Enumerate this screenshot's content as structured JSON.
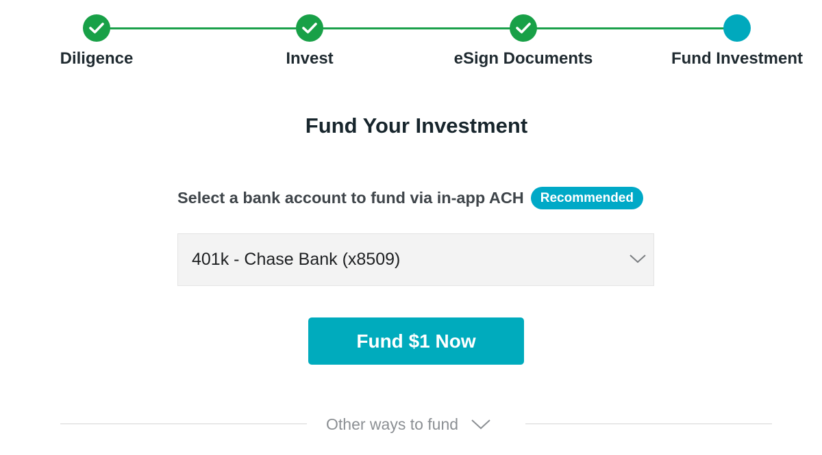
{
  "stepper": {
    "steps": [
      {
        "label": "Diligence",
        "status": "complete",
        "icon": "check-icon"
      },
      {
        "label": "Invest",
        "status": "complete",
        "icon": "check-icon"
      },
      {
        "label": "eSign Documents",
        "status": "complete",
        "icon": "check-icon"
      },
      {
        "label": "Fund Investment",
        "status": "current"
      }
    ]
  },
  "main": {
    "title": "Fund Your Investment",
    "select_label": "Select a bank account to fund via in-app ACH",
    "badge": "Recommended",
    "bank_account": {
      "selected": "401k - Chase Bank (x8509)",
      "icon": "chevron-down-icon"
    },
    "fund_button": "Fund $1 Now"
  },
  "other_ways": {
    "label": "Other ways to fund",
    "icon": "chevron-down-icon"
  },
  "colors": {
    "complete": "#18a047",
    "current": "#00a9bd",
    "accent": "#00abbd",
    "badge": "#00a9c7"
  }
}
